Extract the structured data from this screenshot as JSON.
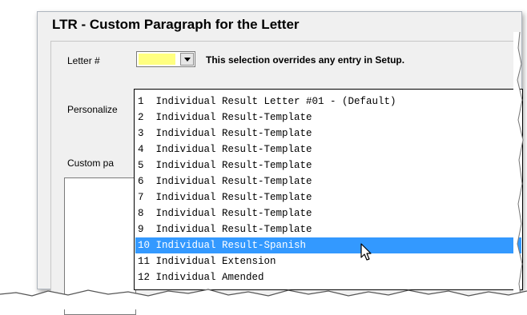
{
  "window": {
    "title": "LTR - Custom Paragraph for the Letter"
  },
  "form": {
    "letter_label": "Letter #",
    "letter_value": "",
    "override_note": "This selection overrides any entry in Setup.",
    "personalize_label": "Personalize",
    "custom_label": "Custom pa"
  },
  "dropdown": {
    "items": [
      "1  Individual Result Letter #01 - (Default)",
      "2  Individual Result-Template",
      "3  Individual Result-Template",
      "4  Individual Result-Template",
      "5  Individual Result-Template",
      "6  Individual Result-Template",
      "7  Individual Result-Template",
      "8  Individual Result-Template",
      "9  Individual Result-Template",
      "10 Individual Result-Spanish",
      "11 Individual Extension",
      "12 Individual Amended"
    ],
    "selected_index": 9
  },
  "colors": {
    "selection": "#3399ff",
    "combo_value_bg": "#ffff80"
  },
  "icons": [
    "chevron-down-icon",
    "mouse-cursor-icon"
  ]
}
